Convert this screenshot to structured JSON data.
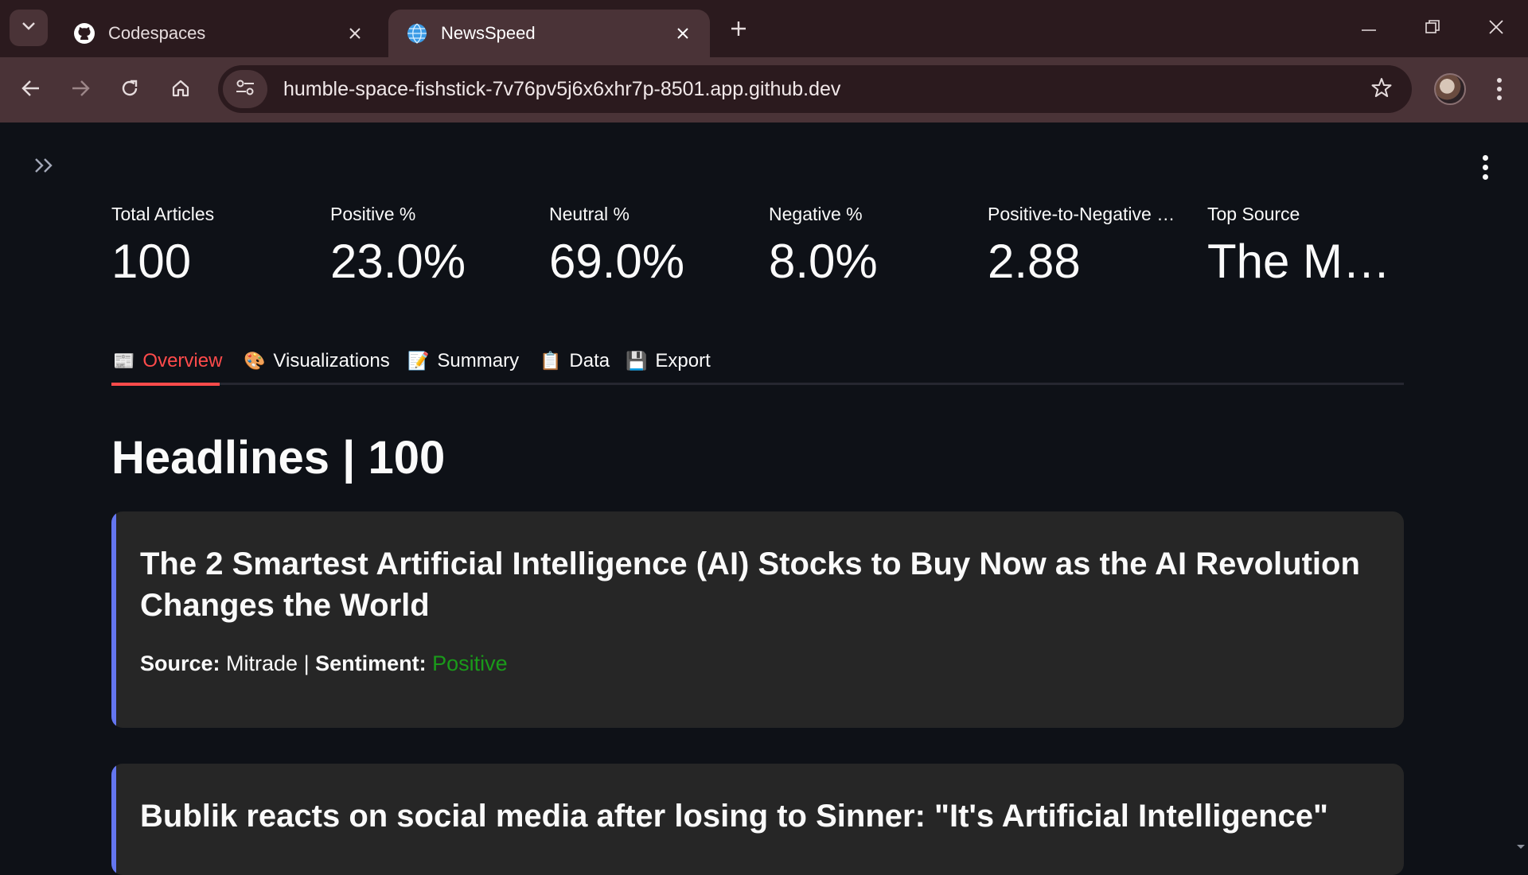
{
  "browser": {
    "tabs": [
      {
        "title": "Codespaces",
        "icon": "github-icon"
      },
      {
        "title": "NewsSpeed",
        "icon": "globe-icon",
        "active": true
      }
    ],
    "url": "humble-space-fishstick-7v76pv5j6x6xhr7p-8501.app.github.dev"
  },
  "metrics": [
    {
      "label": "Total Articles",
      "value": "100"
    },
    {
      "label": "Positive %",
      "value": "23.0%"
    },
    {
      "label": "Neutral %",
      "value": "69.0%"
    },
    {
      "label": "Negative %",
      "value": "8.0%"
    },
    {
      "label": "Positive-to-Negative …",
      "value": "2.88"
    },
    {
      "label": "Top Source",
      "value": "The M…"
    }
  ],
  "tabs": [
    {
      "emoji": "📰",
      "label": "Overview",
      "active": true
    },
    {
      "emoji": "🎨",
      "label": "Visualizations"
    },
    {
      "emoji": "📝",
      "label": "Summary"
    },
    {
      "emoji": "📋",
      "label": "Data"
    },
    {
      "emoji": "💾",
      "label": "Export"
    }
  ],
  "headlines": {
    "title": "Headlines | 100",
    "source_label": "Source:",
    "sentiment_label": "Sentiment:",
    "separator": "|",
    "items": [
      {
        "title": "The 2 Smartest Artificial Intelligence (AI) Stocks to Buy Now as the AI Revolution Changes the World",
        "source": "Mitrade",
        "sentiment": "Positive"
      },
      {
        "title": "Bublik reacts on social media after losing to Sinner: \"It's Artificial Intelligence\""
      }
    ]
  },
  "colors": {
    "accent": "#ff4b4b",
    "card_border": "#6476f0",
    "positive": "#1a9a1a",
    "background": "#0e1117"
  }
}
